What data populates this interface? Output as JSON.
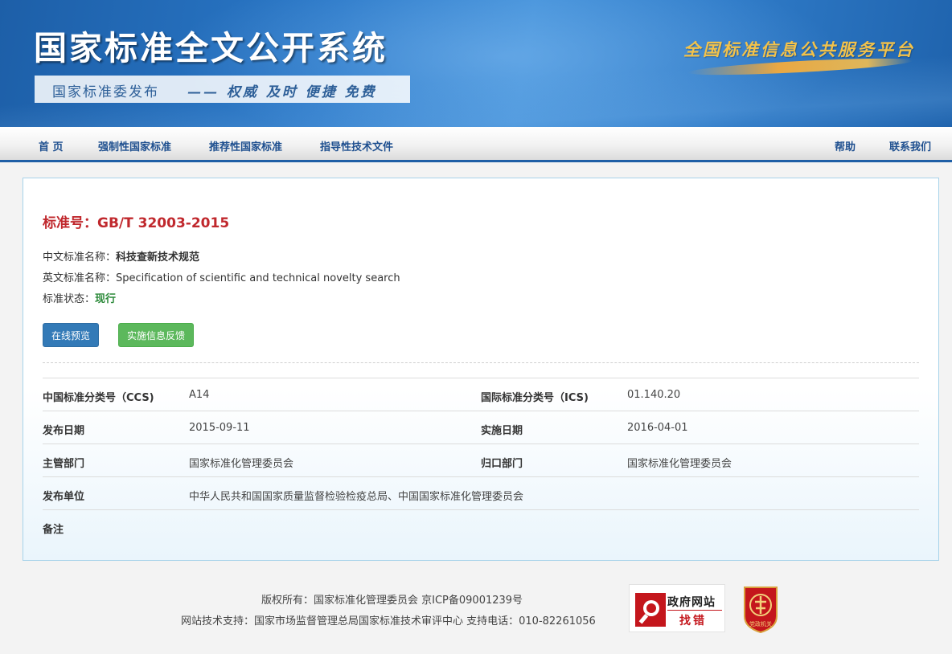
{
  "header": {
    "title": "国家标准全文公开系统",
    "subtitle": "国家标准委发布",
    "slogan": "—— 权威 及时 便捷 免费",
    "platform": "全国标准信息公共服务平台"
  },
  "nav": {
    "home": "首 页",
    "mandatory": "强制性国家标准",
    "recommended": "推荐性国家标准",
    "guidance": "指导性技术文件",
    "help": "帮助",
    "contact": "联系我们"
  },
  "standard": {
    "number_label": "标准号：",
    "number": "GB/T 32003-2015",
    "cn_name_label": "中文标准名称：",
    "cn_name": "科技查新技术规范",
    "en_name_label": "英文标准名称：",
    "en_name": "Specification of scientific and technical novelty search",
    "status_label": "标准状态：",
    "status": "现行"
  },
  "buttons": {
    "preview": "在线预览",
    "feedback": "实施信息反馈"
  },
  "details": {
    "ccs_label": "中国标准分类号（CCS)",
    "ccs": "A14",
    "ics_label": "国际标准分类号（ICS)",
    "ics": "01.140.20",
    "publish_date_label": "发布日期",
    "publish_date": "2015-09-11",
    "impl_date_label": "实施日期",
    "impl_date": "2016-04-01",
    "dept_label": "主管部门",
    "dept": "国家标准化管理委员会",
    "gui_kou_label": "归口部门",
    "gui_kou": "国家标准化管理委员会",
    "publisher_label": "发布单位",
    "publisher": "中华人民共和国国家质量监督检验检疫总局、中国国家标准化管理委员会",
    "remark_label": "备注",
    "remark": ""
  },
  "footer": {
    "copyright": "版权所有：国家标准化管理委员会 京ICP备09001239号",
    "support": "网站技术支持：国家市场监督管理总局国家标准技术审评中心 支持电话：010-82261056",
    "gov_badge_top": "政府网站",
    "gov_badge_bottom": "找错",
    "party_badge": "党政机关"
  },
  "colors": {
    "brand_blue": "#1f5fa6",
    "title_red": "#c0282d",
    "status_green": "#2c8a3a",
    "btn_blue": "#337ab7",
    "btn_green": "#5cb85c"
  }
}
